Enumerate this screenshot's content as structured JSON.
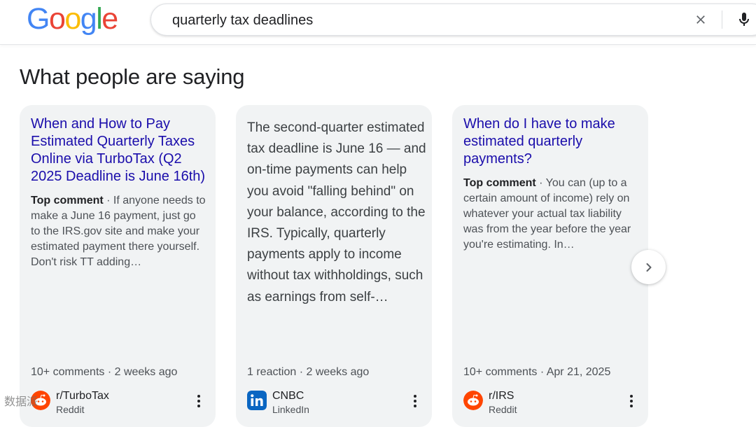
{
  "logo": {
    "letters": [
      "G",
      "o",
      "o",
      "g",
      "l",
      "e"
    ]
  },
  "search": {
    "query": "quarterly tax deadlines"
  },
  "section": {
    "title": "What people are saying"
  },
  "cards": [
    {
      "title": "When and How to Pay Estimated Quarterly Taxes Online via TurboTax (Q2 2025 Deadline is June 16th)",
      "comment_label": "Top comment",
      "comment": " · If anyone needs to make a June 16 payment, just go to the IRS.gov site and make your estimated payment there yourself. Don't risk TT adding…",
      "meta": "10+ comments · 2 weeks ago",
      "source_name": "r/TurboTax",
      "source_site": "Reddit"
    },
    {
      "body": "The second-quarter estimated tax deadline is June 16 — and on-time payments can help you avoid \"falling behind\" on your balance, according to the IRS. Typically, quarterly payments apply to income without tax withholdings, such as earnings from self-…",
      "meta": "1 reaction · 2 weeks ago",
      "source_name": "CNBC",
      "source_site": "LinkedIn"
    },
    {
      "title": "When do I have to make estimated quarterly payments?",
      "comment_label": "Top comment",
      "comment": " · You can (up to a certain amount of income) rely on whatever your actual tax liability was from the year before the year you're estimating. In…",
      "meta": "10+ comments · Apr 21, 2025",
      "source_name": "r/IRS",
      "source_site": "Reddit"
    }
  ],
  "watermark": "数据派",
  "icons": {
    "clear": "close-icon",
    "mic": "mic-icon",
    "next": "chevron-right-icon",
    "more": "more-vert-icon",
    "reddit": "reddit-icon",
    "linkedin": "linkedin-icon"
  },
  "colors": {
    "link": "#1a0dab",
    "google_blue": "#4285f4",
    "google_red": "#ea4335",
    "google_yellow": "#fbbc05",
    "google_green": "#34a853",
    "reddit": "#ff4500",
    "linkedin": "#0a66c2",
    "card_bg": "#f1f3f4"
  }
}
